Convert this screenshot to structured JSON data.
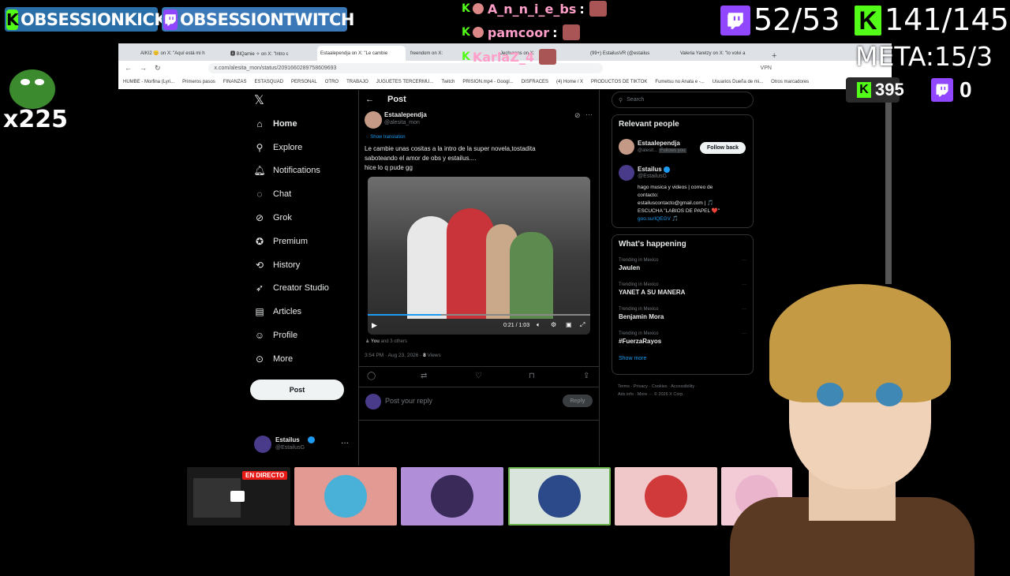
{
  "overlay": {
    "kick_banner": "OBSESSIONKICK",
    "twitch_banner": "OBSESSIONTWITCH",
    "multiplier": "x225",
    "chat": [
      {
        "user": "A_n_n_i_e_bs",
        "sep": ":"
      },
      {
        "user": "pamcoor",
        "sep": ":"
      },
      {
        "user": "KarlaZ_4",
        "sep": ""
      }
    ],
    "twitch_count": "52/53",
    "kick_count": "141/145",
    "meta": "META:15/3",
    "kick_small": "395",
    "twitch_small": "0",
    "kick_letter": "K",
    "live_badge": "EN DIRECTO",
    "colors": {
      "kick": "#53fc18",
      "twitch": "#9146ff"
    }
  },
  "browser": {
    "tabs": [
      "AIKI2 😊 on X: \"Aquí está mi h",
      "🅰 BlQamie ✧ on X: \"Intro c",
      "Estaalependja on X: \"Le cambie",
      "freendom on X:",
      "Jechurens on X:",
      "(99+) EstailusVR (@estailus",
      "Valeria Yaretzy on X: \"lo volvi a"
    ],
    "url": "x.com/alesita_mon/status/2091660289758609693",
    "vpn": "VPN",
    "bookmarks": [
      "HUMBE - Morfina (Lyri...",
      "Primeros pasos",
      "FINANZAS",
      "ESTASQUAD",
      "PERSONAL",
      "OTRO",
      "TRABAJO",
      "JUGUETES TERCERMU...",
      "Twitch",
      "PRISION.mp4 - Googl...",
      "DISFRACES",
      "(4) Home / X",
      "PRODUCTOS DE TIKTOK",
      "Fumetsu no Anata e -...",
      "Usuarios Dueña de mi...",
      "Otros marcadores"
    ]
  },
  "x": {
    "logo": "𝕏",
    "nav": [
      "Home",
      "Explore",
      "Notifications",
      "Chat",
      "Grok",
      "Premium",
      "History",
      "Creator Studio",
      "Articles",
      "Profile",
      "More"
    ],
    "post_button": "Post",
    "account": {
      "name": "Estailus",
      "handle": "@EstailusG"
    },
    "header": "Post",
    "tweet": {
      "name": "Estaalependja",
      "handle": "@alesita_mon",
      "show_translation": "Show translation",
      "text_line1": "Le cambie unas cositas a la intro de la super novela,tostadita",
      "text_line2": "saboteando el amor de obs y estailus....",
      "text_line3": "hice lo q pude gg",
      "video_time": "0:21 / 1:03",
      "liked_by_you": "You",
      "liked_by_rest": "and 3 others",
      "time": "3:54 PM · Aug 23, 2026 ·",
      "views_num": "8",
      "views_label": "Views",
      "reply_placeholder": "Post your reply",
      "reply_button": "Reply"
    },
    "search_placeholder": "Search",
    "relevant": {
      "title": "Relevant people",
      "p1_name": "Estaalependja",
      "p1_handle": "@alesit...",
      "p1_follows": "Follows you",
      "follow_back": "Follow back",
      "p2_name": "Estailus",
      "p2_handle": "@EstailusG",
      "bio1": "hago musica y videos | correo de",
      "bio2": "contacto:",
      "bio3": "estailuscontacto@gmail.com | 🎵",
      "bio4": "ESCUCHA \"LABIOS DE PAPEL ❤️\"",
      "bio5": "goo.su/IQEGV 🎵"
    },
    "happening": {
      "title": "What's happening",
      "trends": [
        {
          "context": "Trending in Mexico",
          "topic": "Jwulen"
        },
        {
          "context": "Trending in Mexico",
          "topic": "YANET A SU MANERA"
        },
        {
          "context": "Trending in Mexico",
          "topic": "Benjamin Mora"
        },
        {
          "context": "Trending in Mexico",
          "topic": "#FuerzaRayos"
        }
      ],
      "show_more": "Show more"
    },
    "footer1": "Terms · Privacy · Cookies · Accessibility ·",
    "footer2": "Ads info · More ··· © 2026 X Corp."
  }
}
